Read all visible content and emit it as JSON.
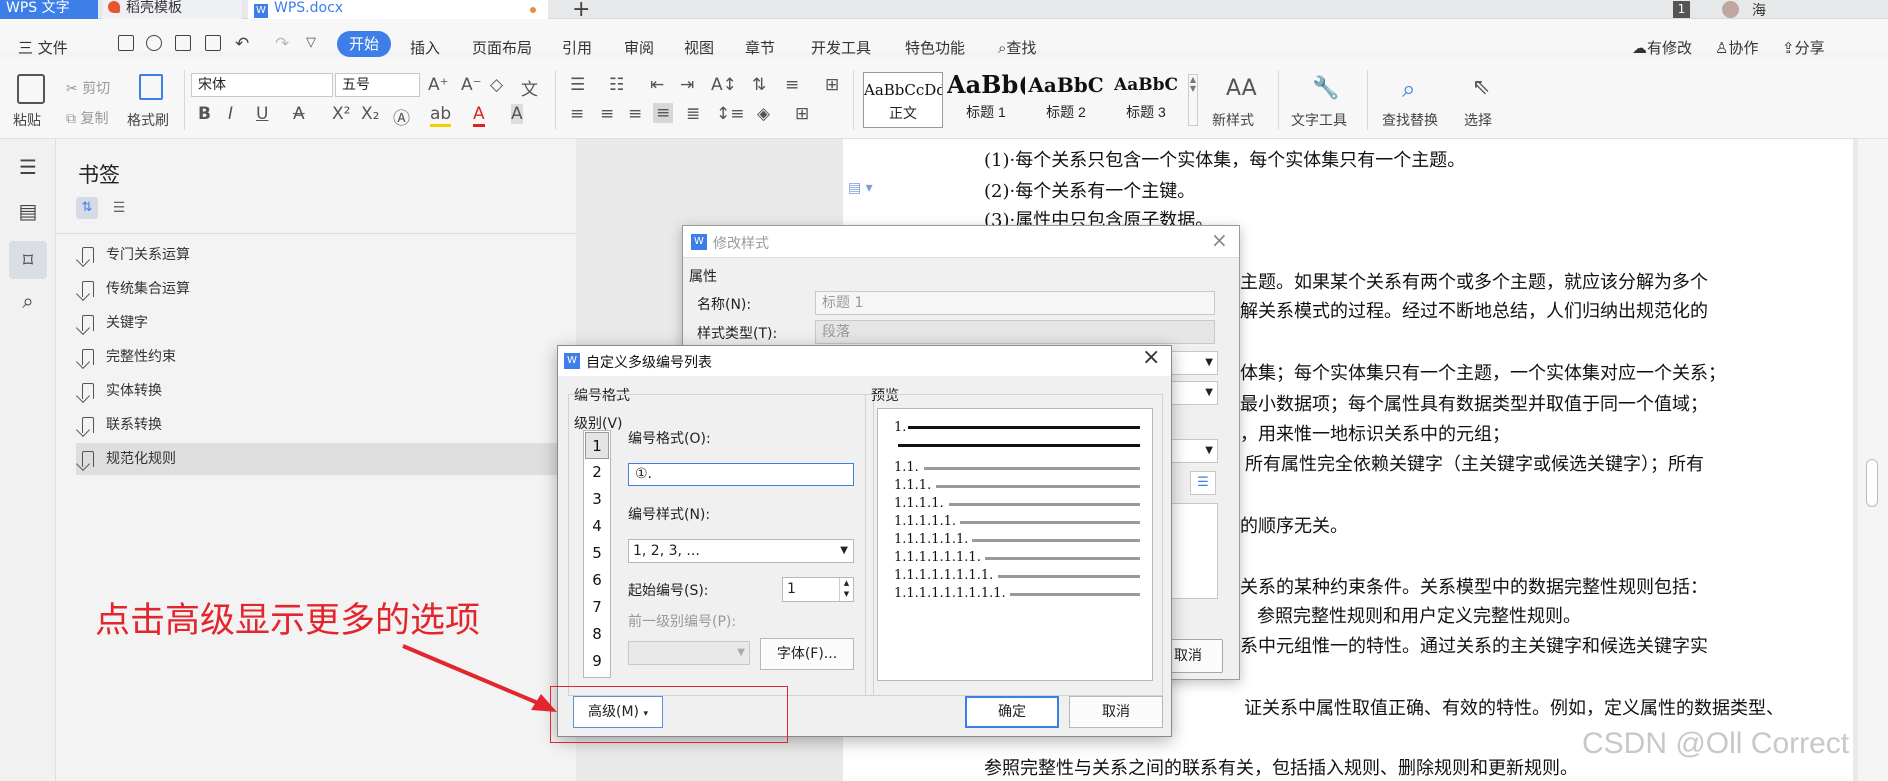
{
  "tabs": {
    "app": "WPS 文字",
    "template": "稻壳模板",
    "doc": "WPS.docx",
    "badge": "1",
    "user": "海"
  },
  "menu": {
    "file": "三 文件",
    "items": [
      "开始",
      "插入",
      "页面布局",
      "引用",
      "审阅",
      "视图",
      "章节",
      "开发工具",
      "特色功能",
      "查找"
    ],
    "right": [
      "有修改",
      "协作",
      "分享"
    ]
  },
  "ribbon": {
    "paste": "粘贴",
    "cut": "剪切",
    "copy": "复制",
    "format_painter": "格式刷",
    "font": "宋体",
    "size": "五号",
    "styles": [
      {
        "preview": "AaBbCcDd",
        "name": "正文"
      },
      {
        "preview": "AaBb(",
        "name": "标题 1"
      },
      {
        "preview": "AaBbC",
        "name": "标题 2"
      },
      {
        "preview": "AaBbC",
        "name": "标题 3"
      }
    ],
    "new_style": "新样式",
    "text_tools": "文字工具",
    "find_replace": "查找替换",
    "select": "选择"
  },
  "pane": {
    "title": "书签",
    "items": [
      "专门关系运算",
      "传统集合运算",
      "关键字",
      "完整性约束",
      "实体转换",
      "联系转换",
      "规范化规则"
    ],
    "selected_index": 6
  },
  "document": {
    "lines": [
      "(1)·每个关系只包含一个实体集，每个实体集只有一个主题。",
      "(2)·每个关系有一个主键。",
      "(3)·属性中只包含原子数据。",
      "主题。如果某个关系有两个或多个主题，就应该分解为多个",
      "解关系模式的过程。经过不断地总结，人们归纳出规范化的",
      "体集；每个实体集只有一个主题，一个实体集对应一个关系；",
      "最小数据项；每个属性具有数据类型并取值于同一个值域；",
      "，用来惟一地标识关系中的元组；",
      "所有属性完全依赖关键字（主关键字或候选关键字）；所有",
      "的顺序无关。",
      "关系的某种约束条件。关系模型中的数据完整性规则包括：",
      "参照完整性规则和用户定义完整性规则。",
      "系中元组惟一的特性。通过关系的主关键字和候选关键字实",
      "证关系中属性取值正确、有效的特性。例如，定义属性的数据类型、",
      "参照完整性与关系之间的联系有关，包括插入规则、删除规则和更新规则。"
    ]
  },
  "dialog_style": {
    "title": "修改样式",
    "section": "属性",
    "name_label": "名称(N):",
    "name_value": "标题 1",
    "type_label": "样式类型(T):",
    "type_value": "段落",
    "cancel": "取消"
  },
  "dialog_list": {
    "title": "自定义多级编号列表",
    "group_format": "编号格式",
    "group_preview": "预览",
    "level_label": "级别(V)",
    "levels": [
      "1",
      "2",
      "3",
      "4",
      "5",
      "6",
      "7",
      "8",
      "9"
    ],
    "format_label": "编号格式(O):",
    "format_value": "①.",
    "style_label": "编号样式(N):",
    "style_value": "1, 2, 3, ...",
    "start_label": "起始编号(S):",
    "start_value": "1",
    "prev_level_label": "前一级别编号(P):",
    "font_button": "字体(F)...",
    "advanced_button": "高级(M)",
    "ok": "确定",
    "cancel": "取消",
    "preview_rows": [
      "1.",
      "1.1.",
      "1.1.1.",
      "1.1.1.1.",
      "1.1.1.1.1.",
      "1.1.1.1.1.1.",
      "1.1.1.1.1.1.1.",
      "1.1.1.1.1.1.1.1.",
      "1.1.1.1.1.1.1.1.1."
    ]
  },
  "annotation": {
    "text": "点击高级显示更多的选项",
    "color": "#e3262d"
  },
  "watermark": "CSDN @Oll Correct"
}
